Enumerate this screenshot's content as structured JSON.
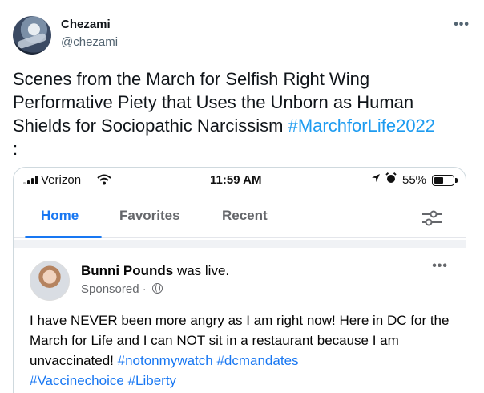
{
  "tweet": {
    "display_name": "Chezami",
    "handle": "@chezami",
    "more_icon": "more-horizontal-icon",
    "text_main": "Scenes from the March for Selfish Right Wing Performative Piety that Uses the Unborn as Human Shields for Sociopathic Narcissism ",
    "hashtag": "#MarchforLife2022",
    "text_end": ":"
  },
  "phone": {
    "carrier": "Verizon",
    "time": "11:59 AM",
    "battery": "55%",
    "battery_level": 0.55,
    "icons": [
      "signal-icon",
      "wifi-icon",
      "location-icon",
      "alarm-icon",
      "battery-icon"
    ]
  },
  "fb": {
    "tabs": [
      {
        "label": "Home",
        "active": true
      },
      {
        "label": "Favorites",
        "active": false
      },
      {
        "label": "Recent",
        "active": false
      }
    ],
    "accent": "#1877f2",
    "post": {
      "name": "Bunni Pounds",
      "action": " was live.",
      "meta": "Sponsored · ",
      "body": "I have NEVER been more angry as I am right now! Here in DC for the March for Life and I can NOT sit in a restaurant because I am unvaccinated! ",
      "tags": [
        "#notonmywatch",
        "#dcmandates",
        "#Vaccinechoice",
        "#Liberty"
      ]
    }
  }
}
